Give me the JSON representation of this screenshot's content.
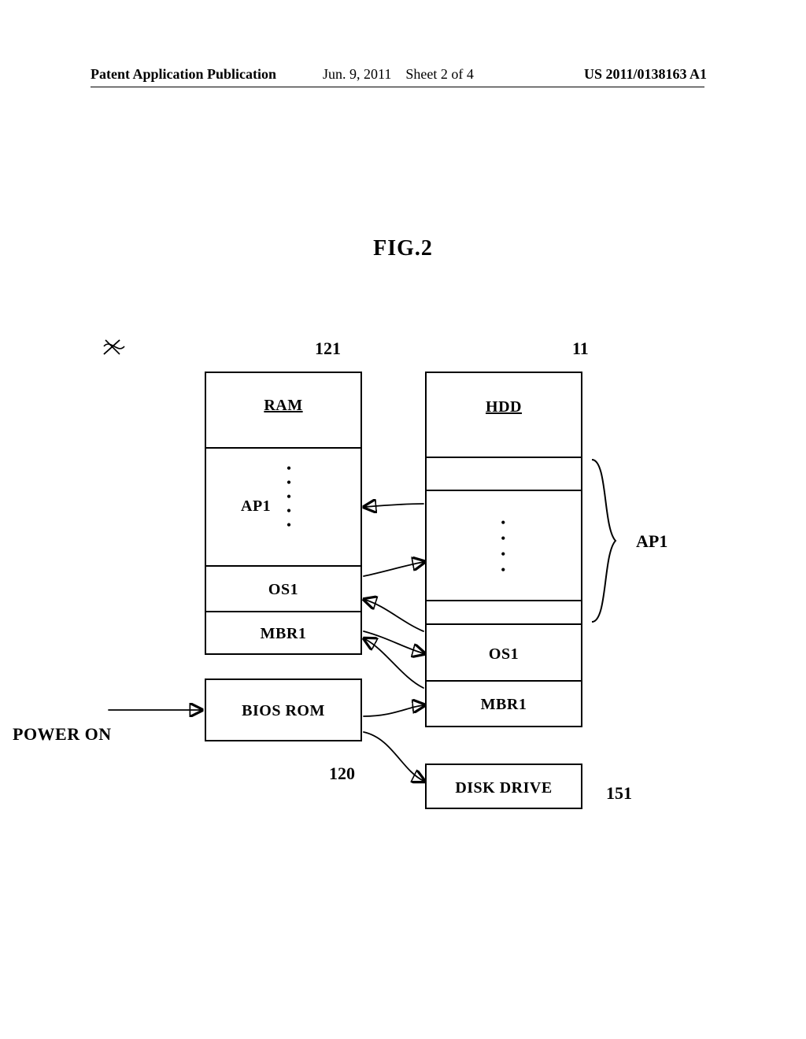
{
  "header": {
    "left": "Patent Application Publication",
    "date": "Jun. 9, 2011",
    "sheet": "Sheet 2 of 4",
    "pubnum": "US 2011/0138163 A1"
  },
  "figure_title": "FIG.2",
  "refs": {
    "r121": "121",
    "r11": "11",
    "r120": "120",
    "r151": "151",
    "ap1_right": "AP1"
  },
  "power_on": "POWER ON",
  "left_stack": {
    "ram": "RAM",
    "ap1": "AP1",
    "os1": "OS1",
    "mbr1": "MBR1",
    "bios": "BIOS ROM"
  },
  "right_stack": {
    "hdd": "HDD",
    "os1": "OS1",
    "mbr1": "MBR1",
    "disk_drive": "DISK DRIVE"
  }
}
